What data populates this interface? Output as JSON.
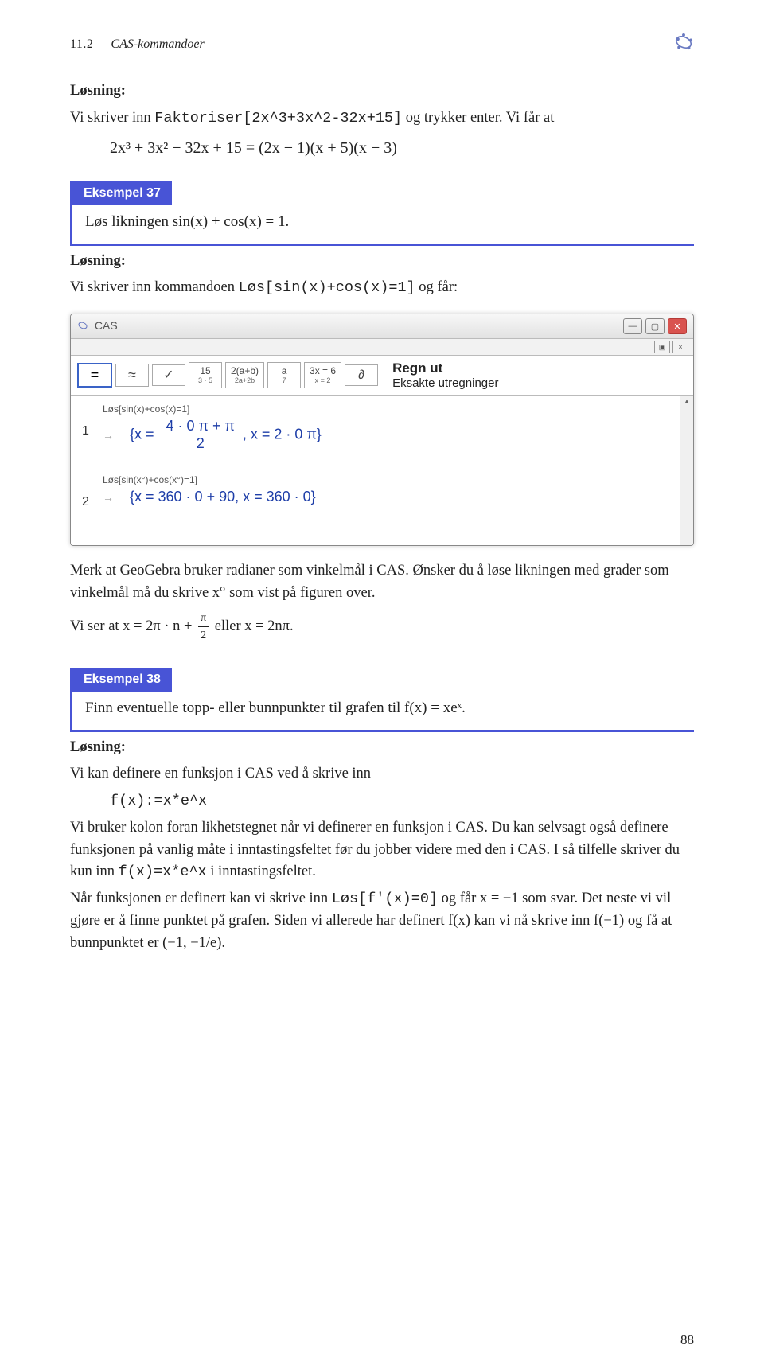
{
  "header": {
    "section_num": "11.2",
    "section_title": "CAS-kommandoer"
  },
  "sol1": {
    "label": "Løsning:",
    "p1_a": "Vi skriver inn ",
    "p1_code": "Faktoriser[2x^3+3x^2-32x+15]",
    "p1_b": " og trykker enter. Vi får at",
    "eq": "2x³ + 3x² − 32x + 15 = (2x − 1)(x + 5)(x − 3)"
  },
  "ex37": {
    "badge": "Eksempel 37",
    "body": "Løs likningen sin(x) + cos(x) = 1."
  },
  "sol2": {
    "label": "Løsning:",
    "p1_a": "Vi skriver inn kommandoen ",
    "p1_code": "Løs[sin(x)+cos(x)=1]",
    "p1_b": " og får:"
  },
  "cas": {
    "title": "CAS",
    "tb": {
      "b1": "=",
      "b2": "≈",
      "b3": "✓",
      "b4_t": "15",
      "b4_b": "3 · 5",
      "b5_t": "2(a+b)",
      "b5_b": "2a+2b",
      "b6_t": "a",
      "b6_b": "7",
      "b7_t": "3x = 6",
      "b7_b": "x = 2",
      "b8": "∂",
      "lab_bold": "Regn ut",
      "lab_sub": "Eksakte utregninger"
    },
    "row1": {
      "idx": "1",
      "small": "Løs[sin(x)+cos(x)=1]",
      "num": "4 · 0 π + π",
      "den": "2",
      "rest": ", x = 2 · 0 π"
    },
    "row2": {
      "idx": "2",
      "small": "Løs[sin(x°)+cos(x°)=1]",
      "math": "{x = 360 · 0 + 90, x = 360 · 0}"
    }
  },
  "after_cas": {
    "p1": "Merk at GeoGebra bruker radianer som vinkelmål i CAS. Ønsker du å løse likningen med grader som vinkelmål må du skrive x° som vist på figuren over.",
    "p2_a": "Vi ser at x = 2π · n + ",
    "p2_num": "π",
    "p2_den": "2",
    "p2_b": "  eller  x = 2nπ."
  },
  "ex38": {
    "badge": "Eksempel 38",
    "body": "Finn eventuelle topp- eller bunnpunkter til grafen til f(x) = xeˣ."
  },
  "sol3": {
    "label": "Løsning:",
    "p1": "Vi kan definere en funksjon i CAS ved å skrive inn",
    "code": "f(x):=x*e^x",
    "p2_a": "Vi bruker kolon foran likhetstegnet når vi definerer en funksjon i CAS. Du kan selvsagt også definere funksjonen på vanlig måte i inntastingsfeltet før du jobber videre med den i CAS. I så tilfelle skriver du kun inn ",
    "p2_code": "f(x)=x*e^x",
    "p2_b": " i inntastingsfeltet.",
    "p3_a": "Når funksjonen er definert kan vi skrive inn ",
    "p3_code": "Løs[f'(x)=0]",
    "p3_b": " og får x = −1 som svar. Det neste vi vil gjøre er å finne punktet på grafen. Siden vi allerede har definert f(x) kan vi nå skrive inn f(−1) og få at bunnpunktet er (−1, −1/e)."
  },
  "pagenum": "88"
}
